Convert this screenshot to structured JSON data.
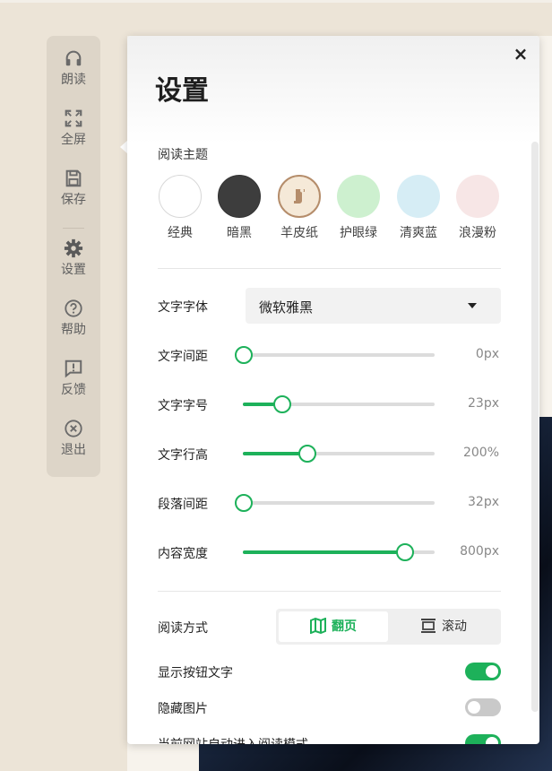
{
  "sidebar": {
    "items": [
      {
        "label": "朗读",
        "icon": "headphones-icon"
      },
      {
        "label": "全屏",
        "icon": "fullscreen-icon"
      },
      {
        "label": "保存",
        "icon": "save-icon"
      },
      {
        "label": "设置",
        "icon": "gear-icon"
      },
      {
        "label": "帮助",
        "icon": "help-icon"
      },
      {
        "label": "反馈",
        "icon": "feedback-icon"
      },
      {
        "label": "退出",
        "icon": "exit-icon"
      }
    ]
  },
  "panel": {
    "title": "设置",
    "close_symbol": "×",
    "theme_label": "阅读主题",
    "themes": [
      {
        "label": "经典",
        "color": "#ffffff"
      },
      {
        "label": "暗黑",
        "color": "#3d3d3d"
      },
      {
        "label": "羊皮纸",
        "color": "#f5e9d8"
      },
      {
        "label": "护眼绿",
        "color": "#cdf0cf"
      },
      {
        "label": "清爽蓝",
        "color": "#d6edf5"
      },
      {
        "label": "浪漫粉",
        "color": "#f7e6e6"
      }
    ],
    "font": {
      "label": "文字字体",
      "value": "微软雅黑"
    },
    "sliders": [
      {
        "label": "文字间距",
        "value": "0px",
        "level": 0
      },
      {
        "label": "文字字号",
        "value": "23px",
        "level": 0.2
      },
      {
        "label": "文字行高",
        "value": "200%",
        "level": 0.33
      },
      {
        "label": "段落间距",
        "value": "32px",
        "level": 0
      },
      {
        "label": "内容宽度",
        "value": "800px",
        "level": 0.84
      }
    ],
    "mode": {
      "label": "阅读方式",
      "options": [
        "翻页",
        "滚动"
      ],
      "selected": "翻页"
    },
    "toggles": [
      {
        "label": "显示按钮文字",
        "on": true
      },
      {
        "label": "隐藏图片",
        "on": false
      },
      {
        "label": "当前网站自动进入阅读模式",
        "on": true
      }
    ]
  },
  "colors": {
    "accent": "#1db15a",
    "sidebar_bg": "#ddd5c8",
    "page_bg": "#ece4d7"
  }
}
